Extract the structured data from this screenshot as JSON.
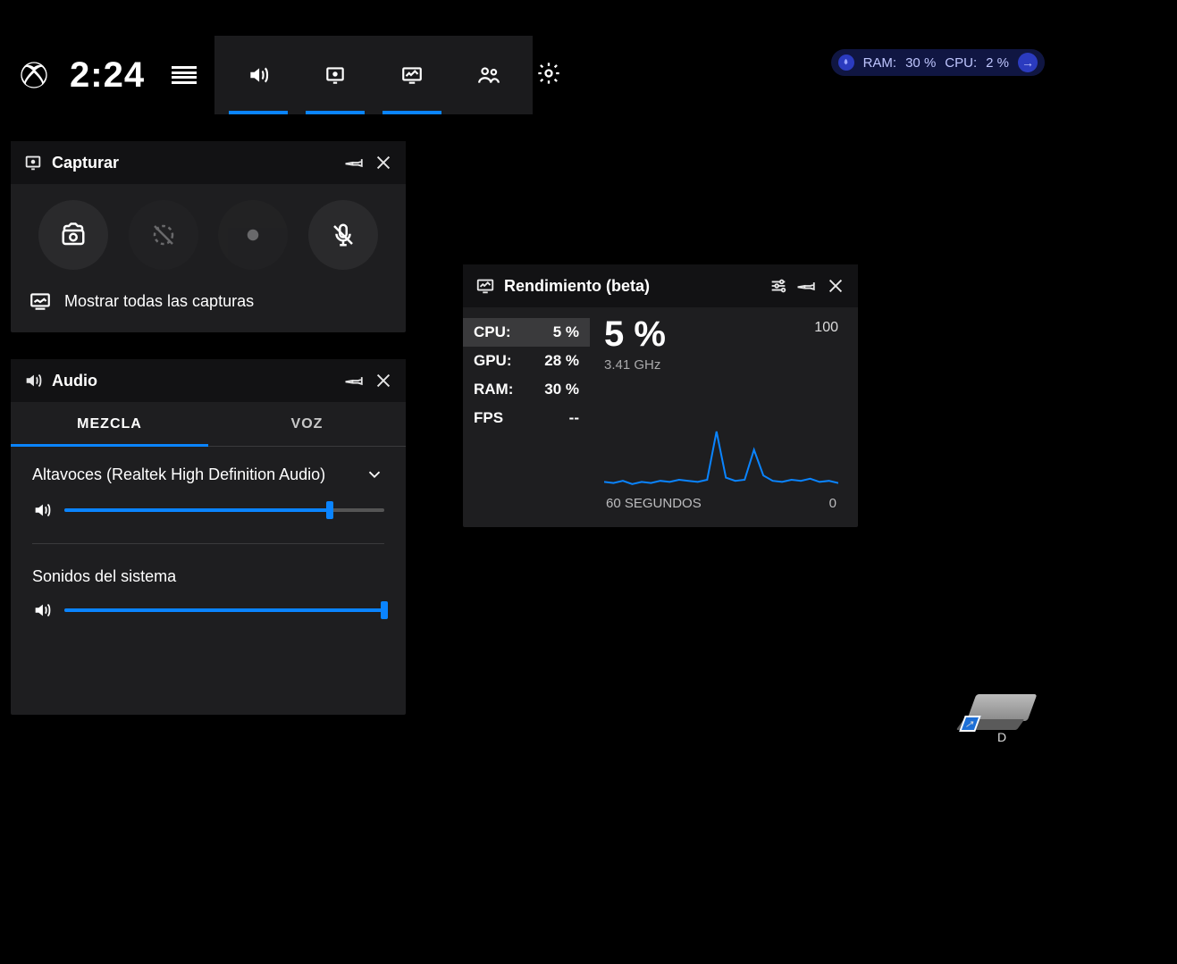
{
  "topbar": {
    "clock": "2:24"
  },
  "statpill": {
    "ram_label": "RAM:",
    "ram_value": "30 %",
    "cpu_label": "CPU:",
    "cpu_value": "2 %"
  },
  "capture": {
    "title": "Capturar",
    "show_all": "Mostrar todas las capturas"
  },
  "audio": {
    "title": "Audio",
    "tabs": {
      "mix": "MEZCLA",
      "voice": "VOZ"
    },
    "device": "Altavoces (Realtek High Definition Audio)",
    "device_volume": 83,
    "system_label": "Sonidos del sistema",
    "system_volume": 100
  },
  "perf": {
    "title": "Rendimiento (beta)",
    "metrics": [
      {
        "label": "CPU:",
        "value": "5 %",
        "selected": true
      },
      {
        "label": "GPU:",
        "value": "28 %",
        "selected": false
      },
      {
        "label": "RAM:",
        "value": "30 %",
        "selected": false
      },
      {
        "label": "FPS",
        "value": "--",
        "selected": false
      }
    ],
    "big_value": "5 %",
    "ymax": "100",
    "freq": "3.41 GHz",
    "xlabel_left": "60 SEGUNDOS",
    "xlabel_right": "0"
  },
  "desktop": {
    "drive_label": "D"
  },
  "chart_data": {
    "type": "line",
    "title": "CPU usage over last 60 seconds",
    "xlabel": "segundos",
    "ylabel": "%",
    "ylim": [
      0,
      100
    ],
    "x": [
      60,
      57,
      54,
      51,
      48,
      45,
      42,
      39,
      36,
      33,
      30,
      27,
      26,
      25,
      24,
      23,
      21,
      20,
      19,
      18,
      15,
      12,
      9,
      6,
      3,
      0
    ],
    "values": [
      8,
      7,
      9,
      6,
      8,
      7,
      9,
      8,
      10,
      9,
      8,
      10,
      55,
      12,
      9,
      10,
      38,
      14,
      9,
      8,
      10,
      9,
      11,
      8,
      9,
      7
    ]
  }
}
